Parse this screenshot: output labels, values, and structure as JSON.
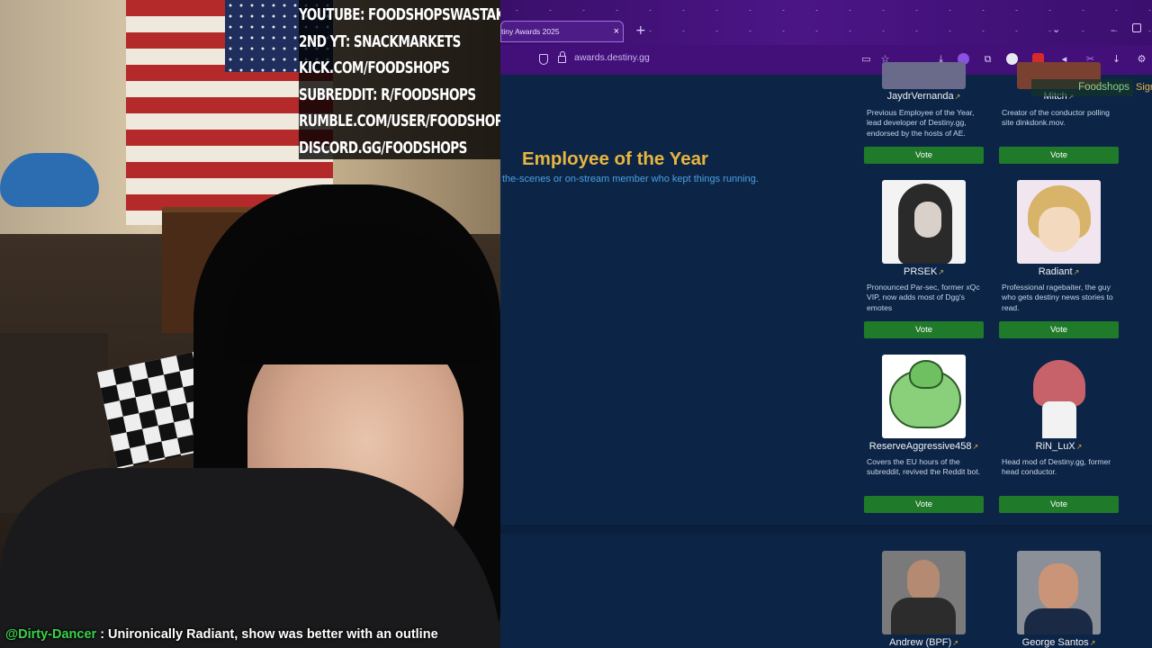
{
  "overlay": {
    "socials": [
      "YOUTUBE: FOODSHOPSWASTAKEN",
      "2ND YT: SNACKMARKETS",
      "KICK.COM/FOODSHOPS",
      "SUBREDDIT: R/FOODSHOPS",
      "RUMBLE.COM/USER/FOODSHOPS",
      "DISCORD.GG/FOODSHOPS"
    ],
    "chat": {
      "user": "@Dirty-Dancer",
      "message": " : Unironically Radiant, show was better with an outline"
    }
  },
  "browser": {
    "tab_title": "tiny Awards 2025",
    "tab_close": "×",
    "new_tab": "+",
    "minimize": "–",
    "tabs_menu": "⌄",
    "url": "awards.destiny.gg",
    "user_chip": "Foodshops",
    "sign_chip": "Sign"
  },
  "page": {
    "category": {
      "title": "Employee of the Year",
      "description": "the-scenes or on-stream member who kept things running."
    },
    "ext_glyph": "↗",
    "candidates": [
      {
        "name": "JaydrVernanda",
        "description": "Previous Employee of the Year, lead developer of Destiny.gg, endorsed by the hosts of AE.",
        "vote": "Vote"
      },
      {
        "name": "Mitch",
        "description": "Creator of the conductor polling site dinkdonk.mov.",
        "vote": "Vote"
      },
      {
        "name": "PRSEK",
        "description": "Pronounced Par-sec, former xQc VIP, now adds most of Dgg's emotes",
        "vote": "Vote"
      },
      {
        "name": "Radiant",
        "description": "Professional ragebaiter, the guy who gets destiny news stories to read.",
        "vote": "Vote"
      },
      {
        "name": "ReserveAggressive458",
        "description": "Covers the EU hours of the subreddit, revived the Reddit bot.",
        "vote": "Vote"
      },
      {
        "name": "RiN_LuX",
        "description": "Head mod of Destiny.gg, former head conductor.",
        "vote": "Vote"
      },
      {
        "name": "Andrew (BPF)"
      },
      {
        "name": "George Santos"
      }
    ]
  },
  "icons": {
    "shield": "shield-icon",
    "lock": "lock-icon",
    "external_link": "external-link-icon"
  },
  "colors": {
    "page_bg": "#0c2547",
    "title_gold": "#e8b63e",
    "desc_blue": "#4aa0e0",
    "vote_green": "#1f7a2a",
    "browser_purple": "#43107a",
    "chat_user_green": "#3ad24a"
  }
}
